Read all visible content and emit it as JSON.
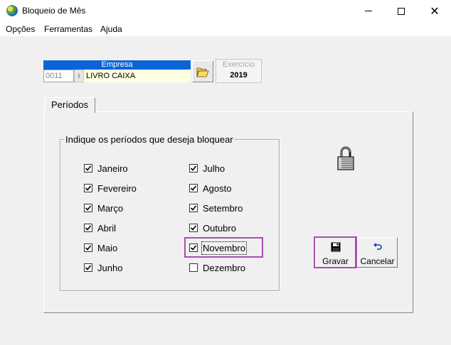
{
  "window": {
    "title": "Bloqueio de Mês"
  },
  "menu": {
    "items": [
      "Opções",
      "Ferramentas",
      "Ajuda"
    ]
  },
  "empresa": {
    "header": "Empresa",
    "code": "0011",
    "name": "LIVRO CAIXA"
  },
  "exercicio": {
    "label": "Exercício",
    "value": "2019"
  },
  "tabs": [
    {
      "label": "Períodos"
    }
  ],
  "periods": {
    "group_label": "Indique os períodos que deseja bloquear",
    "months": [
      {
        "label": "Janeiro",
        "checked": true
      },
      {
        "label": "Fevereiro",
        "checked": true
      },
      {
        "label": "Março",
        "checked": true
      },
      {
        "label": "Abril",
        "checked": true
      },
      {
        "label": "Maio",
        "checked": true
      },
      {
        "label": "Junho",
        "checked": true
      },
      {
        "label": "Julho",
        "checked": true
      },
      {
        "label": "Agosto",
        "checked": true
      },
      {
        "label": "Setembro",
        "checked": true
      },
      {
        "label": "Outubro",
        "checked": true
      },
      {
        "label": "Novembro",
        "checked": true
      },
      {
        "label": "Dezembro",
        "checked": false
      }
    ]
  },
  "buttons": {
    "save_label": "Gravar",
    "cancel_label": "Cancelar"
  },
  "colors": {
    "highlight": "#a64fb0",
    "header_blue": "#0a64d8",
    "name_field_bg": "#ffffe1"
  },
  "icons": [
    "app-icon",
    "folder-open-icon",
    "padlock-icon",
    "floppy-disk-icon",
    "undo-arrow-icon"
  ]
}
